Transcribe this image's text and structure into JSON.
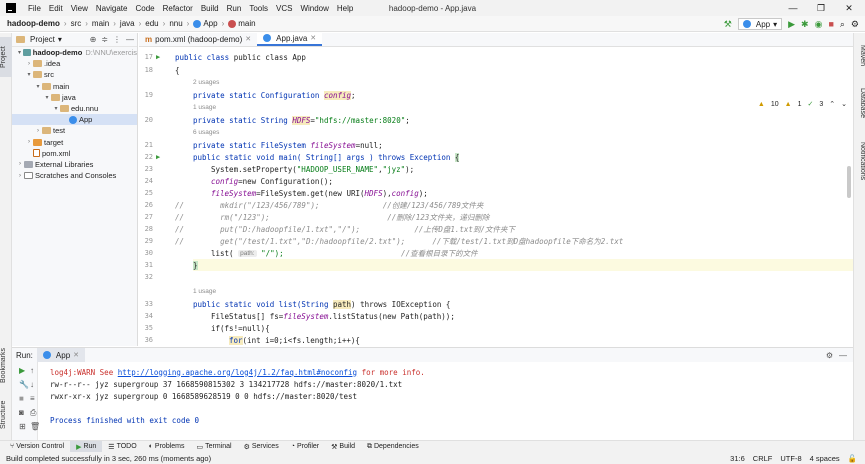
{
  "menubar": {
    "items": [
      "File",
      "Edit",
      "View",
      "Navigate",
      "Code",
      "Refactor",
      "Build",
      "Run",
      "Tools",
      "VCS",
      "Window",
      "Help"
    ],
    "title": "hadoop-demo - App.java"
  },
  "breadcrumb": [
    "hadoop-demo",
    "src",
    "main",
    "java",
    "edu",
    "nnu",
    "App",
    "main"
  ],
  "navright": {
    "run_config": "App"
  },
  "project_panel": {
    "title": "Project",
    "tree": [
      {
        "label": "hadoop-demo",
        "hint": "D:\\NNU\\exercis",
        "depth": 0,
        "arrow": "▾",
        "icon": "mod",
        "bold": true
      },
      {
        "label": ".idea",
        "depth": 1,
        "arrow": "›",
        "icon": "folder"
      },
      {
        "label": "src",
        "depth": 1,
        "arrow": "▾",
        "icon": "folder"
      },
      {
        "label": "main",
        "depth": 2,
        "arrow": "▾",
        "icon": "folder"
      },
      {
        "label": "java",
        "depth": 3,
        "arrow": "▾",
        "icon": "folder"
      },
      {
        "label": "edu.nnu",
        "depth": 4,
        "arrow": "▾",
        "icon": "folder"
      },
      {
        "label": "App",
        "depth": 5,
        "arrow": "",
        "icon": "class",
        "selected": true
      },
      {
        "label": "test",
        "depth": 2,
        "arrow": "›",
        "icon": "folder"
      },
      {
        "label": "target",
        "depth": 1,
        "arrow": "›",
        "icon": "orange"
      },
      {
        "label": "pom.xml",
        "depth": 1,
        "arrow": "",
        "icon": "file"
      },
      {
        "label": "External Libraries",
        "depth": 0,
        "arrow": "›",
        "icon": "lib"
      },
      {
        "label": "Scratches and Consoles",
        "depth": 0,
        "arrow": "›",
        "icon": "scratch"
      }
    ]
  },
  "tabs": [
    {
      "label": "pom.xml (hadoop-demo)",
      "active": false
    },
    {
      "label": "App.java",
      "active": true
    }
  ],
  "inspections": {
    "warnings": "10",
    "weak": "1",
    "ok": "3"
  },
  "gutter": [
    {
      "n": "17",
      "run": true
    },
    {
      "n": "18"
    },
    {
      "n": ""
    },
    {
      "n": "19"
    },
    {
      "n": ""
    },
    {
      "n": "20"
    },
    {
      "n": ""
    },
    {
      "n": "21"
    },
    {
      "n": "22",
      "run": true
    },
    {
      "n": "23"
    },
    {
      "n": "24"
    },
    {
      "n": "25"
    },
    {
      "n": "26"
    },
    {
      "n": "27"
    },
    {
      "n": "28"
    },
    {
      "n": "29"
    },
    {
      "n": "30"
    },
    {
      "n": "31"
    },
    {
      "n": "32"
    },
    {
      "n": ""
    },
    {
      "n": "33"
    },
    {
      "n": "34"
    },
    {
      "n": "35"
    },
    {
      "n": "36"
    }
  ],
  "code": {
    "l17": "public class App",
    "l18": "{",
    "u19": "2 usages",
    "l19a": "private static Configuration ",
    "l19b": "config",
    "l19c": ";",
    "u20": "1 usage",
    "l20a": "private static String ",
    "l20b": "HDFS",
    "l20c": "=",
    "l20d": "\"hdfs://master:8020\"",
    "l20e": ";",
    "u21": "6 usages",
    "l21a": "private static FileSystem ",
    "l21b": "fileSystem",
    "l21c": "=null;",
    "l22a": "public static void main( String[] args ) throws Exception ",
    "l22b": "{",
    "l23a": "System.setProperty(",
    "l23b": "\"HADOOP_USER_NAME\"",
    "l23c": ",",
    "l23d": "\"jyz\"",
    "l23e": ");",
    "l24a": "config",
    "l24b": "=new Configuration();",
    "l25a": "fileSystem",
    "l25b": "=FileSystem.get(new URI(",
    "l25c": "HDFS",
    "l25d": "),",
    "l25e": "config",
    "l25f": ");",
    "l26": "//        mkdir(\"/123/456/789\");              //创建/123/456/789文件夹",
    "l27": "//        rm(\"/123\");                          //删除/123文件夹，递归删除",
    "l28": "//        put(\"D:/hadoopfile/1.txt\",\"/\");            //上传D盘1.txt到/文件夹下",
    "l29": "//        get(\"/test/1.txt\",\"D:/hadoopfile/2.txt\");      //下载/test/1.txt到D盘hadoopfile下命名为2.txt",
    "l30a": "list( ",
    "l30hint": "path:",
    "l30b": " \"/\");",
    "l30c": "                          //查看根目录下的文件",
    "l31": "}",
    "u33": "1 usage",
    "l33a": "public static void list(String ",
    "l33b": "path",
    "l33c": ") throws IOException {",
    "l34a": "FileStatus[] fs=",
    "l34b": "fileSystem",
    "l34c": ".listStatus(new Path(path));",
    "l35": "if(fs!=null){",
    "l36a": "for",
    "l36b": "(int i=0;i<fs.length;i++){"
  },
  "runpanel": {
    "label": "Run:",
    "tab": "App",
    "console": {
      "warn_a": "log4j:WARN See ",
      "warn_link": "http://logging.apache.org/log4j/1.2/faq.html#noconfig",
      "warn_b": " for more info.",
      "out1": "rw-r--r-- jyz supergroup 37 1668590815302 3 134217728 hdfs://master:8020/1.txt",
      "out2": "rwxr-xr-x jyz supergroup 0 1668589628519 0 0 hdfs://master:8020/test",
      "exit": "Process finished with exit code 0"
    }
  },
  "left_stripe": {
    "project": "Project",
    "bookmarks": "Bookmarks",
    "structure": "Structure"
  },
  "right_stripe": {
    "maven": "Maven",
    "database": "Database",
    "notifications": "Notifications"
  },
  "toolwindows": [
    "Version Control",
    "Run",
    "TODO",
    "Problems",
    "Terminal",
    "Services",
    "Profiler",
    "Build",
    "Dependencies"
  ],
  "status": {
    "message": "Build completed successfully in 3 sec, 260 ms (moments ago)",
    "position": "31:6",
    "line_sep": "CRLF",
    "encoding": "UTF-8",
    "indent": "4 spaces"
  },
  "colors": {
    "accent": "#3875d7",
    "keyword": "#0033b3",
    "string": "#067d17",
    "field": "#871094",
    "comment": "#8c8c8c"
  }
}
